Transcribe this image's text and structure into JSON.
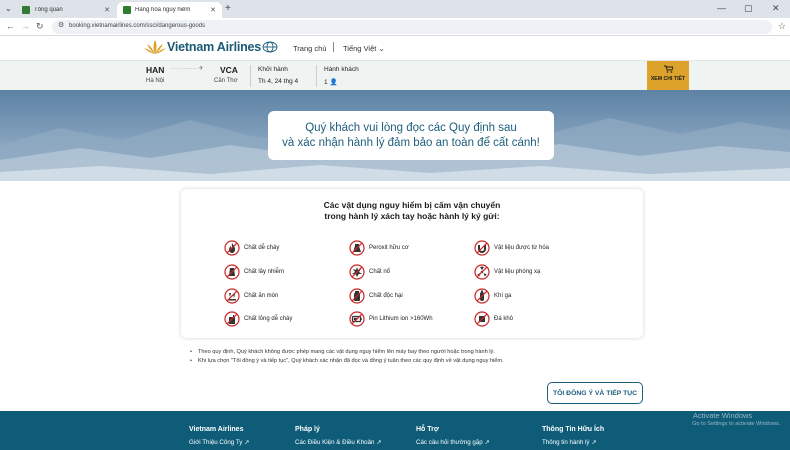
{
  "browser": {
    "tabs": [
      {
        "label": "Tổng quan"
      },
      {
        "label": "Hàng hóa nguy hiểm"
      }
    ],
    "url": "booking.vietnamairlines.com/ssci/dangerous-goods"
  },
  "site": {
    "logo": "Vietnam Airlines",
    "nav_home": "Trang chủ",
    "nav_lang": "Tiếng Việt"
  },
  "booking": {
    "origin_code": "HAN",
    "origin_city": "Hà Nội",
    "dest_code": "VCA",
    "dest_city": "Cần Thơ",
    "route_dots": "···········✈",
    "depart_label": "Khởi hành",
    "depart_value": "Th 4, 24 thg 4",
    "pax_label": "Hành khách",
    "pax_value": "1",
    "detail_button": "XEM CHI TIẾT"
  },
  "hero": {
    "line1": "Quý khách vui lòng đọc các Quy định sau",
    "line2": "và xác nhận hành lý đảm bảo an toàn để cất cánh!"
  },
  "card": {
    "title_line1": "Các vật dụng nguy hiểm bị cấm vận chuyển",
    "title_line2": "trong hành lý xách tay hoặc hành lý ký gửi:",
    "items": [
      {
        "label": "Chất dễ cháy",
        "icon": "fire-icon"
      },
      {
        "label": "Peroxit hữu cơ",
        "icon": "peroxide-icon"
      },
      {
        "label": "Vật liệu được từ hóa",
        "icon": "magnet-icon"
      },
      {
        "label": "Chất lây nhiễm",
        "icon": "biohazard-icon"
      },
      {
        "label": "Chất nổ",
        "icon": "explosive-icon"
      },
      {
        "label": "Vật liệu phóng xạ",
        "icon": "radiation-icon"
      },
      {
        "label": "Chất ăn mòn",
        "icon": "corrosive-icon"
      },
      {
        "label": "Chất độc hại",
        "icon": "toxic-icon"
      },
      {
        "label": "Khí ga",
        "icon": "gas-cylinder-icon"
      },
      {
        "label": "Chất lỏng dễ cháy",
        "icon": "flammable-liquid-icon"
      },
      {
        "label": "Pin Lithium ion >160Wh",
        "icon": "battery-icon"
      },
      {
        "label": "Đá khô",
        "icon": "dry-ice-icon"
      }
    ]
  },
  "notes": [
    "Theo quy định, Quý khách không được phép mang các vật dụng nguy hiểm lên máy bay theo người hoặc trong hành lý.",
    "Khi lựa chọn \"Tôi đồng ý và tiếp tục\", Quý khách xác nhận đã đọc và đồng ý tuân theo các quy định về vật dụng nguy hiểm."
  ],
  "agree_button": "TÔI ĐỒNG Ý VÀ TIẾP TỤC",
  "footer": {
    "columns": [
      {
        "heading": "Vietnam Airlines",
        "link": "Giới Thiệu Công Ty"
      },
      {
        "heading": "Pháp lý",
        "link": "Các Điều Kiện & Điều Khoản"
      },
      {
        "heading": "Hỗ Trợ",
        "link": "Các câu hỏi thường gặp"
      },
      {
        "heading": "Thông Tin Hữu Ích",
        "link": "Thông tin hành lý"
      }
    ],
    "watermark_title": "Activate Windows",
    "watermark_sub": "Go to Settings to activate Windows."
  },
  "colors": {
    "brand": "#1d5e7c",
    "gold": "#dca22a",
    "danger": "#c62828",
    "footer": "#0e5c78"
  }
}
